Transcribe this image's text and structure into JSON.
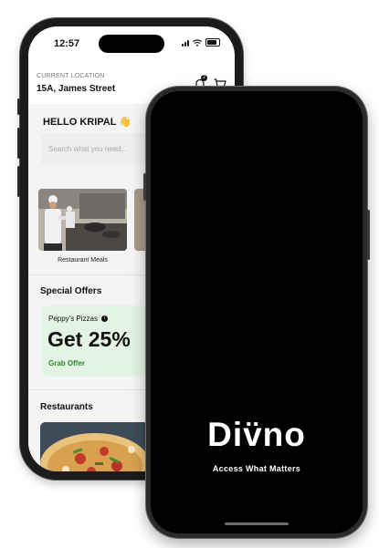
{
  "back_phone": {
    "status": {
      "time": "12:57"
    },
    "header": {
      "location_label": "CURRENT LOCATION",
      "address": "15A, James Street",
      "notification_count": "2"
    },
    "greeting": "HELLO KRIPAL 👋",
    "search": {
      "placeholder": "Search what you need..."
    },
    "categories": [
      {
        "label": "Restaurant Meals"
      }
    ],
    "special_offers": {
      "title": "Special Offers",
      "card": {
        "brand": "Peppy's Pizzas",
        "info_icon": "i",
        "headline": "Get 25%",
        "cta": "Grab Offer"
      }
    },
    "restaurants": {
      "title": "Restaurants"
    }
  },
  "front_phone": {
    "brand": "Div̈no",
    "tagline": "Access What Matters"
  },
  "colors": {
    "offer_bg": "#e4f4e4",
    "offer_cta": "#2e8b2e",
    "splash_bg": "#000000",
    "phone_frame": "#1c1c1e"
  },
  "icons": [
    "signal-icon",
    "wifi-icon",
    "battery-icon",
    "bell-icon",
    "cart-icon",
    "info-icon"
  ]
}
